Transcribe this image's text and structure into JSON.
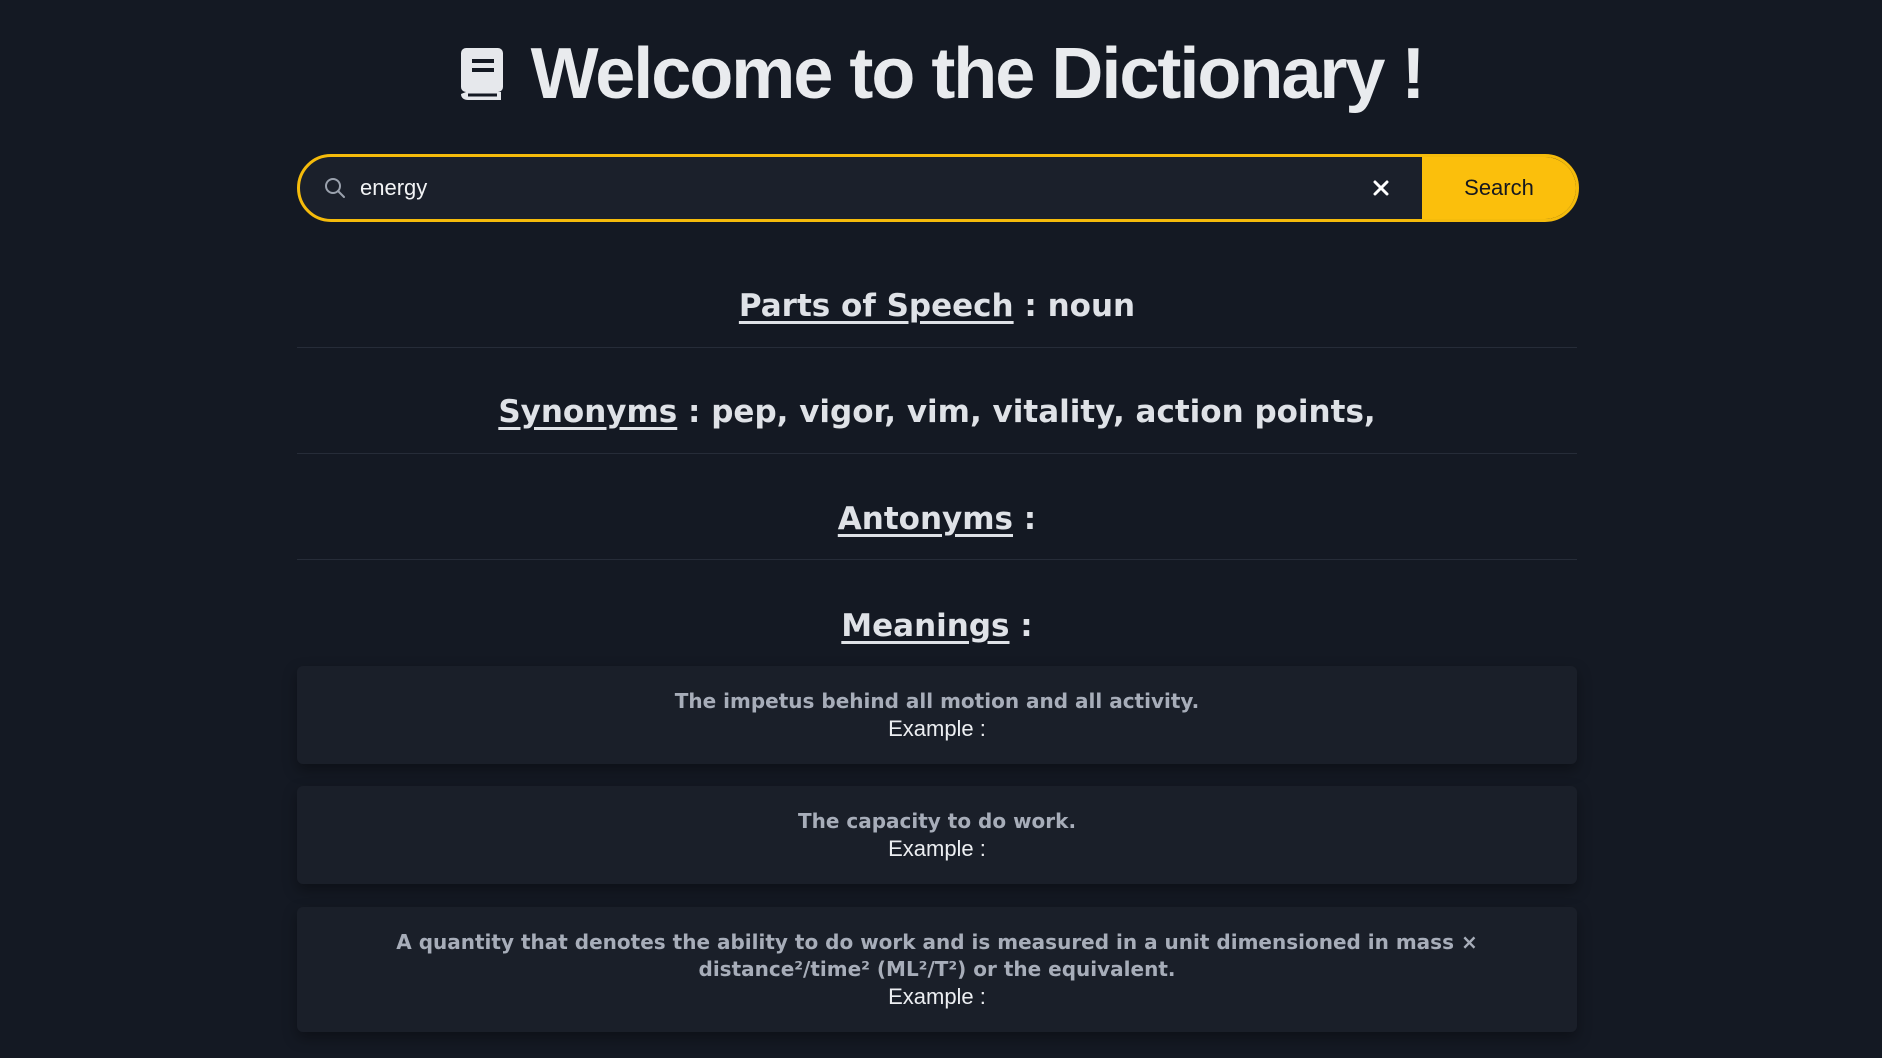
{
  "header": {
    "icon": "book-icon",
    "title": "Welcome to the Dictionary !"
  },
  "search": {
    "value": "energy",
    "placeholder": "",
    "search_icon": "search-icon",
    "clear_icon": "close-icon",
    "button_label": "Search"
  },
  "colors": {
    "accent": "#fbbf0c",
    "background": "#141923",
    "card": "#1a1f29"
  },
  "parts_of_speech": {
    "label": "Parts of Speech",
    "separator": " : ",
    "value": "noun"
  },
  "synonyms": {
    "label": "Synonyms",
    "separator": " : ",
    "value": "pep, vigor, vim, vitality, action points,"
  },
  "antonyms": {
    "label": "Antonyms",
    "separator": " :",
    "value": ""
  },
  "meanings": {
    "label": "Meanings",
    "separator": " :",
    "items": [
      {
        "definition": "The impetus behind all motion and all activity.",
        "example_label": "Example :"
      },
      {
        "definition": "The capacity to do work.",
        "example_label": "Example :"
      },
      {
        "definition": "A quantity that denotes the ability to do work and is measured in a unit dimensioned in mass × distance²/time² (ML²/T²) or the equivalent.",
        "example_label": "Example :"
      }
    ]
  }
}
